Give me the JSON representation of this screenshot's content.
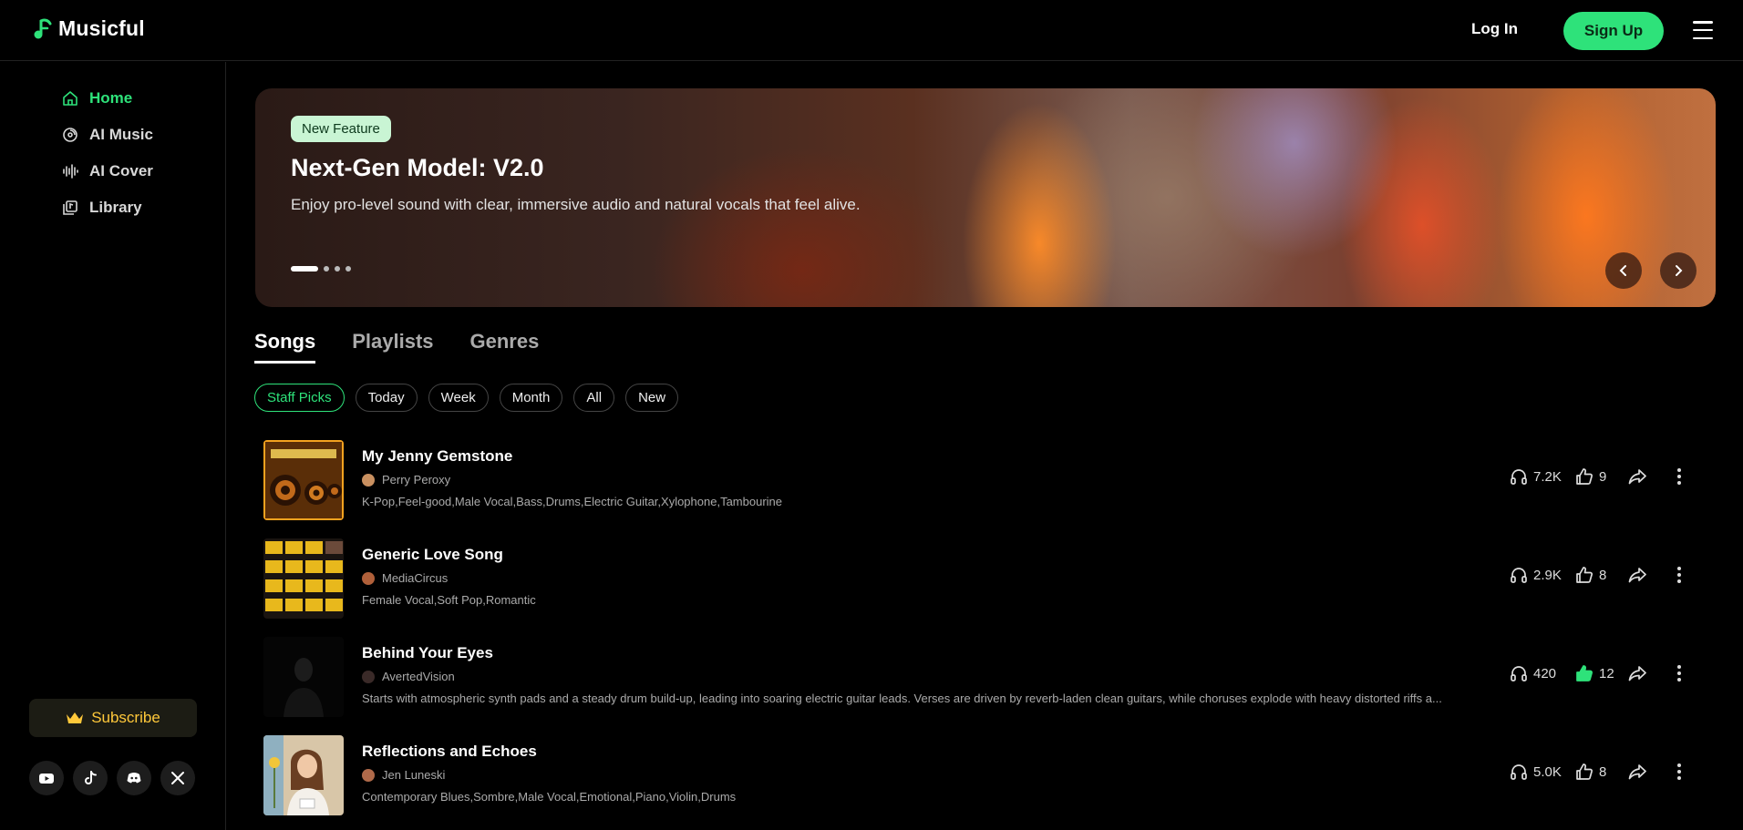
{
  "brand": {
    "name": "Musicful",
    "accent": "#2ee27a"
  },
  "header": {
    "login": "Log In",
    "signup": "Sign Up",
    "menu_icon": "hamburger-icon"
  },
  "sidebar": {
    "items": [
      {
        "label": "Home",
        "icon": "home-icon",
        "active": true
      },
      {
        "label": "AI Music",
        "icon": "disc-icon",
        "active": false
      },
      {
        "label": "AI Cover",
        "icon": "waveform-icon",
        "active": false
      },
      {
        "label": "Library",
        "icon": "library-icon",
        "active": false
      }
    ],
    "subscribe": "Subscribe",
    "socials": [
      "youtube-icon",
      "tiktok-icon",
      "discord-icon",
      "x-icon"
    ]
  },
  "banner": {
    "badge": "New Feature",
    "title": "Next-Gen Model: V2.0",
    "description": "Enjoy pro-level sound with clear, immersive audio and natural vocals that feel alive.",
    "slide_count": 4,
    "active_slide": 1
  },
  "tabs": [
    {
      "label": "Songs",
      "active": true
    },
    {
      "label": "Playlists",
      "active": false
    },
    {
      "label": "Genres",
      "active": false
    }
  ],
  "filters": [
    {
      "label": "Staff Picks",
      "active": true
    },
    {
      "label": "Today",
      "active": false
    },
    {
      "label": "Week",
      "active": false
    },
    {
      "label": "Month",
      "active": false
    },
    {
      "label": "All",
      "active": false
    },
    {
      "label": "New",
      "active": false
    }
  ],
  "songs": [
    {
      "title": "My Jenny Gemstone",
      "artist": "Perry Peroxy",
      "tags": "K-Pop,Feel-good,Male Vocal,Bass,Drums,Electric Guitar,Xylophone,Tambourine",
      "plays": "7.2K",
      "likes": "9",
      "liked": false
    },
    {
      "title": "Generic Love Song",
      "artist": "MediaCircus",
      "tags": "Female Vocal,Soft Pop,Romantic",
      "plays": "2.9K",
      "likes": "8",
      "liked": false
    },
    {
      "title": "Behind Your Eyes",
      "artist": "AvertedVision",
      "tags": "Starts with atmospheric synth pads and a steady drum build-up, leading into soaring electric guitar leads. Verses are driven by reverb-laden clean guitars, while choruses explode with heavy distorted riffs a...",
      "plays": "420",
      "likes": "12",
      "liked": true
    },
    {
      "title": "Reflections and Echoes",
      "artist": "Jen Luneski",
      "tags": "Contemporary Blues,Sombre,Male Vocal,Emotional,Piano,Violin,Drums",
      "plays": "5.0K",
      "likes": "8",
      "liked": false
    }
  ]
}
